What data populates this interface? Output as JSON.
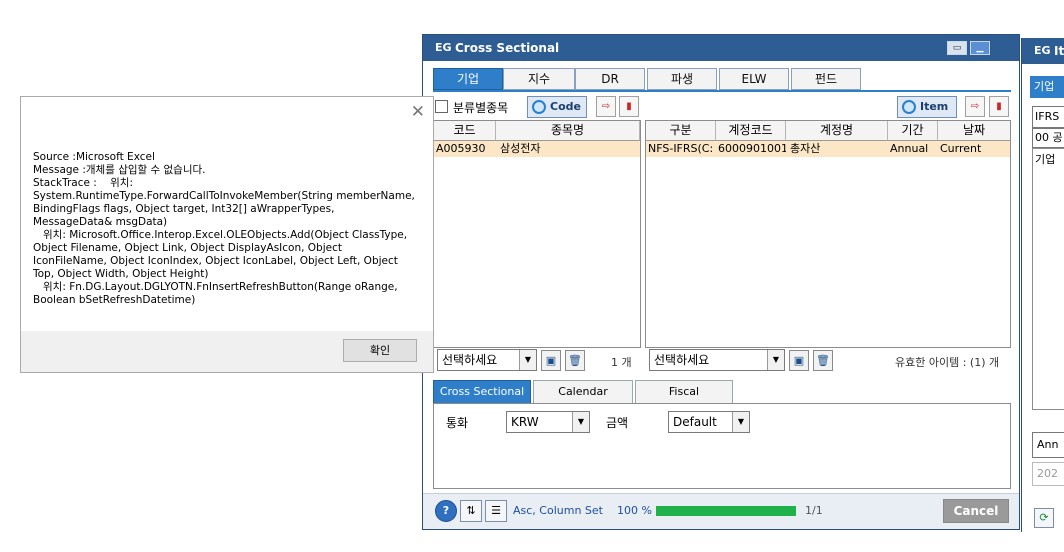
{
  "cross_sectional": {
    "title": "Cross Sectional",
    "logo": "EG",
    "titlebar_icons": [
      "restore-icon",
      "minimize-icon"
    ],
    "tabs": [
      "기업",
      "지수",
      "DR",
      "파생",
      "ELW",
      "펀드"
    ],
    "active_tab": "기업",
    "classify_checkbox_label": "분류별종목",
    "code_button_label": "Code",
    "item_button_label": "Item",
    "left_grid": {
      "headers": [
        "코드",
        "종목명"
      ],
      "rows": [
        {
          "code": "A005930",
          "name": "삼성전자"
        }
      ]
    },
    "right_grid": {
      "headers": [
        "구분",
        "계정코드",
        "계정명",
        "기간",
        "날짜"
      ],
      "rows": [
        {
          "type": "NFS-IFRS(C:",
          "account_code": "6000901001",
          "account_name": "총자산",
          "period": "Annual",
          "date": "Current"
        }
      ]
    },
    "left_select_value": "선택하세요",
    "left_count": "1 개",
    "right_select_value": "선택하세요",
    "right_count": "유효한 아이템 : (1) 개",
    "sub_tabs": [
      "Cross Sectional",
      "Calendar",
      "Fiscal"
    ],
    "options": {
      "currency_label": "통화",
      "currency_value": "KRW",
      "amount_label": "금액",
      "amount_value": "Default"
    },
    "status": {
      "help_label": "?",
      "sort_text": "Asc, Column Set",
      "progress_text": "100 %",
      "progress_fraction": 1.0,
      "page_text": "1/1",
      "cancel_label": "Cancel"
    }
  },
  "item_window": {
    "title": "It",
    "fragments": [
      "기업",
      "IFRS",
      "00 공",
      "기업",
      "Ann",
      "202"
    ]
  },
  "error_dialog": {
    "message": "Source :Microsoft Excel\nMessage :개체를 삽입할 수 없습니다.\nStackTrace :    위치:\nSystem.RuntimeType.ForwardCallToInvokeMember(String memberName,\nBindingFlags flags, Object target, Int32[] aWrapperTypes,\nMessageData& msgData)\n   위치: Microsoft.Office.Interop.Excel.OLEObjects.Add(Object ClassType,\nObject Filename, Object Link, Object DisplayAsIcon, Object\nIconFileName, Object IconIndex, Object IconLabel, Object Left, Object\nTop, Object Width, Object Height)\n   위치: Fn.DG.Layout.DGLYOTN.FnInsertRefreshButton(Range oRange,\nBoolean bSetRefreshDatetime)",
    "ok_label": "확인",
    "close_icon": "close-icon"
  },
  "colors": {
    "titlebar": "#2e5d93",
    "active_tab": "#2f7ec9",
    "selected_row": "#fbe6c6",
    "progress": "#1fb14a",
    "export_icon": "#c62828"
  }
}
